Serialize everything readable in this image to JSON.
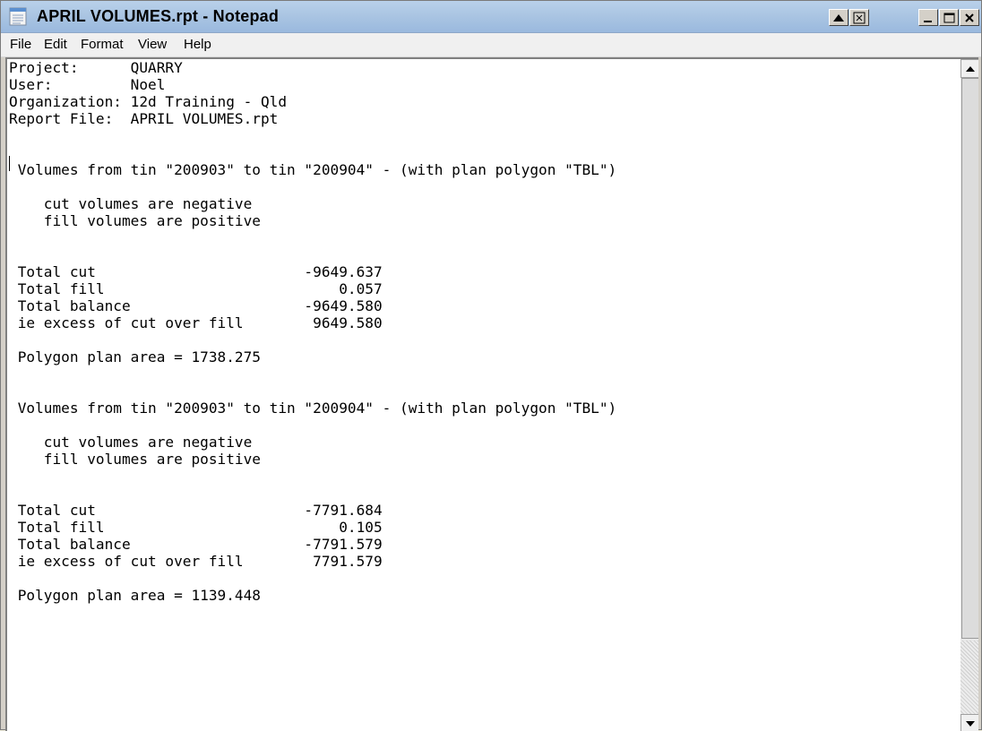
{
  "window": {
    "title": "APRIL VOLUMES.rpt - Notepad",
    "title_bar_color": "#a9c4e2"
  },
  "titlebar_buttons": [
    {
      "name": "scroll-up-arrow-icon"
    },
    {
      "name": "restore-app-icon"
    },
    {
      "name": "minimize-icon"
    },
    {
      "name": "maximize-icon"
    },
    {
      "name": "close-icon"
    }
  ],
  "menu": {
    "file": "File",
    "edit": "Edit",
    "format": "Format",
    "view": "View",
    "help": "Help"
  },
  "document": {
    "lines": [
      "Project:      QUARRY",
      "User:         Noel",
      "Organization: 12d Training - Qld",
      "Report File:  APRIL VOLUMES.rpt",
      "",
      "",
      " Volumes from tin \"200903\" to tin \"200904\" - (with plan polygon \"TBL\")",
      "",
      "    cut volumes are negative",
      "    fill volumes are positive",
      "",
      "",
      " Total cut                        -9649.637",
      " Total fill                           0.057",
      " Total balance                    -9649.580",
      " ie excess of cut over fill        9649.580",
      "",
      " Polygon plan area = 1738.275",
      "",
      "",
      " Volumes from tin \"200903\" to tin \"200904\" - (with plan polygon \"TBL\")",
      "",
      "    cut volumes are negative",
      "    fill volumes are positive",
      "",
      "",
      " Total cut                        -7791.684",
      " Total fill                           0.105",
      " Total balance                    -7791.579",
      " ie excess of cut over fill        7791.579",
      "",
      " Polygon plan area = 1139.448"
    ]
  },
  "scrollbar": {
    "up_icon": "scroll-up-arrow-icon",
    "down_icon": "scroll-down-arrow-icon"
  }
}
